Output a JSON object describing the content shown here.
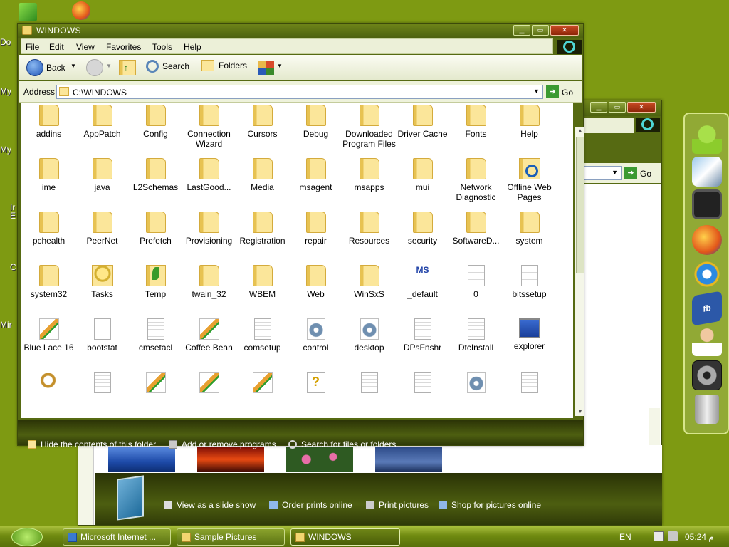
{
  "desktop": {
    "labels": [
      "Do",
      "My",
      "My",
      "Ir\nE",
      "C",
      "Mir"
    ]
  },
  "window": {
    "title": "WINDOWS",
    "menu": [
      "File",
      "Edit",
      "View",
      "Favorites",
      "Tools",
      "Help"
    ],
    "toolbar": {
      "back": "Back",
      "search": "Search",
      "folders": "Folders"
    },
    "address": {
      "label": "Address",
      "value": "C:\\WINDOWS",
      "go": "Go"
    },
    "items": [
      {
        "label": "addins",
        "icon": "folder-icon"
      },
      {
        "label": "AppPatch",
        "icon": "folder-icon"
      },
      {
        "label": "Config",
        "icon": "folder-icon"
      },
      {
        "label": "Connection Wizard",
        "icon": "folder-icon"
      },
      {
        "label": "Cursors",
        "icon": "folder-icon"
      },
      {
        "label": "Debug",
        "icon": "folder-icon"
      },
      {
        "label": "Downloaded Program Files",
        "icon": "folder-icon"
      },
      {
        "label": "Driver Cache",
        "icon": "folder-icon"
      },
      {
        "label": "Fonts",
        "icon": "folder-icon"
      },
      {
        "label": "Help",
        "icon": "folder-icon"
      },
      {
        "label": "ime",
        "icon": "folder-icon"
      },
      {
        "label": "java",
        "icon": "folder-icon"
      },
      {
        "label": "L2Schemas",
        "icon": "folder-icon"
      },
      {
        "label": "LastGood...",
        "icon": "folder-icon"
      },
      {
        "label": "Media",
        "icon": "folder-icon"
      },
      {
        "label": "msagent",
        "icon": "folder-icon"
      },
      {
        "label": "msapps",
        "icon": "folder-icon"
      },
      {
        "label": "mui",
        "icon": "folder-icon"
      },
      {
        "label": "Network Diagnostic",
        "icon": "folder-icon"
      },
      {
        "label": "Offline Web Pages",
        "icon": "offline-folder-icon"
      },
      {
        "label": "pchealth",
        "icon": "folder-icon"
      },
      {
        "label": "PeerNet",
        "icon": "folder-icon"
      },
      {
        "label": "Prefetch",
        "icon": "folder-icon"
      },
      {
        "label": "Provisioning",
        "icon": "folder-icon"
      },
      {
        "label": "Registration",
        "icon": "folder-icon"
      },
      {
        "label": "repair",
        "icon": "folder-icon"
      },
      {
        "label": "Resources",
        "icon": "folder-icon"
      },
      {
        "label": "security",
        "icon": "folder-icon"
      },
      {
        "label": "SoftwareD...",
        "icon": "folder-icon"
      },
      {
        "label": "system",
        "icon": "folder-icon"
      },
      {
        "label": "system32",
        "icon": "folder-icon"
      },
      {
        "label": "Tasks",
        "icon": "tasks-folder-icon"
      },
      {
        "label": "Temp",
        "icon": "temp-folder-icon"
      },
      {
        "label": "twain_32",
        "icon": "folder-icon"
      },
      {
        "label": "WBEM",
        "icon": "folder-icon"
      },
      {
        "label": "Web",
        "icon": "folder-icon"
      },
      {
        "label": "WinSxS",
        "icon": "folder-icon"
      },
      {
        "label": "_default",
        "icon": "ms-shortcut-icon"
      },
      {
        "label": "0",
        "icon": "text-file-icon"
      },
      {
        "label": "bitssetup",
        "icon": "text-file-icon"
      },
      {
        "label": "Blue Lace 16",
        "icon": "paint-file-icon"
      },
      {
        "label": "bootstat",
        "icon": "blank-file-icon"
      },
      {
        "label": "cmsetacl",
        "icon": "text-file-icon"
      },
      {
        "label": "Coffee Bean",
        "icon": "paint-file-icon"
      },
      {
        "label": "comsetup",
        "icon": "text-file-icon"
      },
      {
        "label": "control",
        "icon": "gear-file-icon"
      },
      {
        "label": "desktop",
        "icon": "gear-file-icon"
      },
      {
        "label": "DPsFnshr",
        "icon": "text-file-icon"
      },
      {
        "label": "DtcInstall",
        "icon": "text-file-icon"
      },
      {
        "label": "explorer",
        "icon": "explorer-icon"
      },
      {
        "label": "",
        "icon": "search-file-icon"
      },
      {
        "label": "",
        "icon": "text-file-icon"
      },
      {
        "label": "",
        "icon": "paint-file-icon"
      },
      {
        "label": "",
        "icon": "paint-file-icon"
      },
      {
        "label": "",
        "icon": "paint-file-icon"
      },
      {
        "label": "",
        "icon": "help-file-icon"
      },
      {
        "label": "",
        "icon": "text-file-icon"
      },
      {
        "label": "",
        "icon": "text-file-icon"
      },
      {
        "label": "",
        "icon": "gear-file-icon"
      },
      {
        "label": "",
        "icon": "text-file-icon"
      }
    ],
    "tasks": [
      "Hide the contents of this folder",
      "Add or remove programs",
      "Search for files or folders"
    ]
  },
  "back_window": {
    "address": {
      "go": "Go"
    },
    "tasks": [
      "View as a slide show",
      "Order prints online",
      "Print pictures",
      "Shop for pictures online"
    ]
  },
  "dock": {
    "icons": [
      "android-icon",
      "satellite-icon",
      "tablet-icon",
      "firefox-icon",
      "internet-explorer-icon",
      "facebook-icon",
      "support-agent-icon",
      "settings-gear-icon",
      "trash-icon"
    ]
  },
  "taskbar": {
    "buttons": [
      "Microsoft Internet ...",
      "Sample Pictures",
      "WINDOWS"
    ],
    "language": "EN",
    "time": "05:24 م"
  }
}
